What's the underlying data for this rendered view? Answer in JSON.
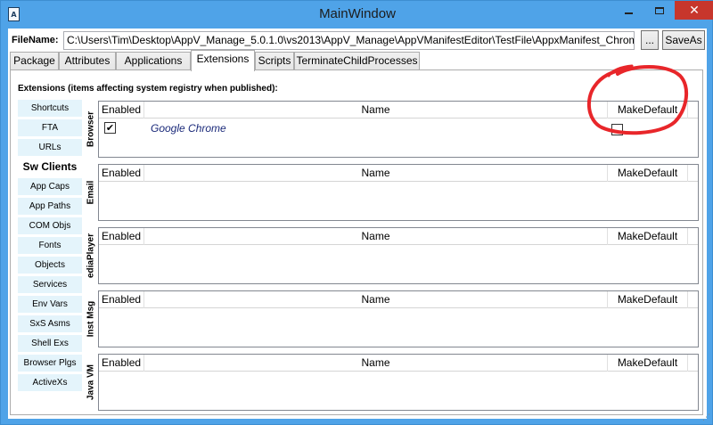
{
  "window": {
    "title": "MainWindow",
    "app_icon_letter": "A",
    "min_icon": "minimize-icon",
    "max_icon": "maximize-icon",
    "close_icon": "close-icon",
    "close_glyph": "✕",
    "accent": "#4fa3e8",
    "close_color": "#c7362c"
  },
  "filebar": {
    "label": "FileName:",
    "path": "C:\\Users\\Tim\\Desktop\\AppV_Manage_5.0.1.0\\vs2013\\AppV_Manage\\AppVManifestEditor\\TestFile\\AppxManifest_Chrome",
    "browse_label": "...",
    "saveas_label": "SaveAs"
  },
  "tabs": [
    {
      "label": "Package"
    },
    {
      "label": "Attributes"
    },
    {
      "label": "Applications"
    },
    {
      "label": "Extensions"
    },
    {
      "label": "Scripts"
    },
    {
      "label": "TerminateChildProcesses"
    }
  ],
  "active_tab": "Extensions",
  "extensions": {
    "section_title": "Extensions (items affecting system registry when published):",
    "sidebar": [
      {
        "label": "Shortcuts"
      },
      {
        "label": "FTA"
      },
      {
        "label": "URLs"
      },
      {
        "label": "Sw Clients"
      },
      {
        "label": "App Caps"
      },
      {
        "label": "App Paths"
      },
      {
        "label": "COM Objs"
      },
      {
        "label": "Fonts"
      },
      {
        "label": "Objects"
      },
      {
        "label": "Services"
      },
      {
        "label": "Env Vars"
      },
      {
        "label": "SxS Asms"
      },
      {
        "label": "Shell Exs"
      },
      {
        "label": "Browser Plgs"
      },
      {
        "label": "ActiveXs"
      }
    ],
    "active_sidebar": "Sw Clients",
    "columns": {
      "enabled": "Enabled",
      "name": "Name",
      "makedefault": "MakeDefault"
    },
    "groups": [
      {
        "label": "Browser",
        "rows": [
          {
            "enabled": true,
            "name": "Google Chrome",
            "makedefault": false
          }
        ]
      },
      {
        "label": "Email",
        "rows": []
      },
      {
        "label": "ediaPlayer",
        "rows": []
      },
      {
        "label": "Inst Msg",
        "rows": []
      },
      {
        "label": "Java VM",
        "rows": []
      }
    ]
  },
  "annotation_color": "#e8262a",
  "check_glyph": "✔",
  "grip_glyph": "⋰"
}
